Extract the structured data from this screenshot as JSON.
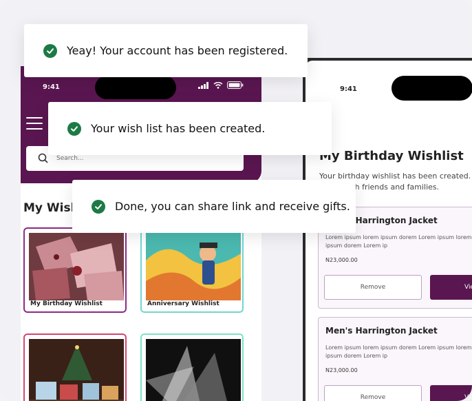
{
  "toasts": [
    {
      "message": "Yeay! Your account has been registered."
    },
    {
      "message": "Your wish list has been created."
    },
    {
      "message": "Done, you can share link and receive gifts."
    }
  ],
  "left_phone": {
    "time": "9:41",
    "search_placeholder": "Search...",
    "section_title": "My Wishlists",
    "cards": [
      {
        "caption": "My Birthday Wishlist"
      },
      {
        "caption": "Anniversary Wishlist"
      },
      {
        "caption": ""
      },
      {
        "caption": ""
      }
    ]
  },
  "right_phone": {
    "time": "9:41",
    "title": "My Birthday Wishlist",
    "subtitle": "Your birthday wishlist has been created. Share with friends and families.",
    "items": [
      {
        "name": "Men's Harrington Jacket",
        "desc": "Lorem ipsum lorem ipsum dorem Lorem ipsum lorem ipsum dorem Lorem ip",
        "price": "N23,000.00",
        "remove_label": "Remove",
        "view_label": "View"
      },
      {
        "name": "Men's Harrington Jacket",
        "desc": "Lorem ipsum lorem ipsum dorem Lorem ipsum lorem ipsum dorem Lorem ip",
        "price": "N23,000.00",
        "remove_label": "Remove",
        "view_label": "View"
      }
    ]
  },
  "colors": {
    "brand_purple": "#5a1650",
    "success_green": "#1d7a45"
  },
  "icons": [
    "check-circle-icon",
    "search-icon",
    "menu-icon",
    "signal-icon",
    "wifi-icon",
    "battery-icon"
  ]
}
